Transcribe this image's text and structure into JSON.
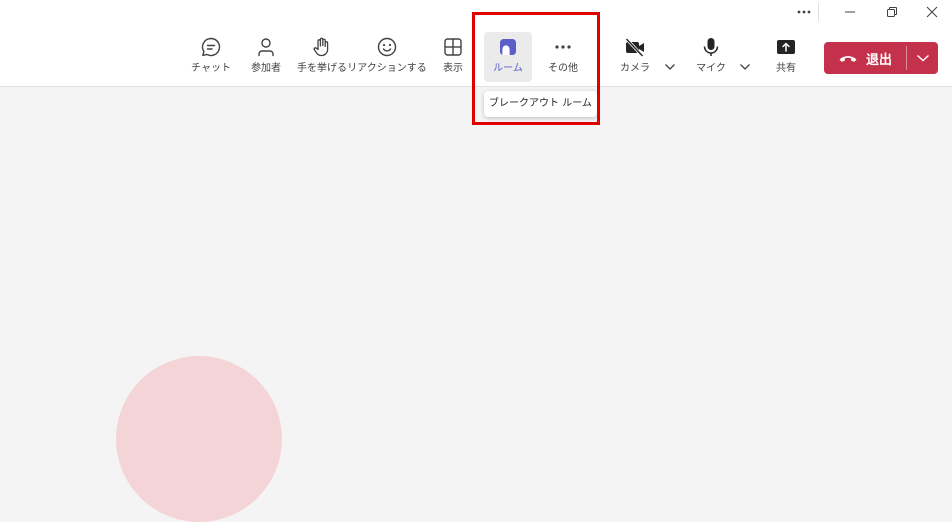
{
  "titlebar": {
    "more_icon": "more-horizontal-icon",
    "minimize_icon": "minimize-icon",
    "restore_icon": "restore-icon",
    "close_icon": "close-icon"
  },
  "toolbar": {
    "chat": {
      "label": "チャット",
      "icon": "chat-icon"
    },
    "participants": {
      "label": "参加者",
      "icon": "people-icon"
    },
    "raise_hand": {
      "label": "手を挙げる",
      "icon": "hand-icon"
    },
    "react": {
      "label": "リアクションする",
      "icon": "smiley-icon"
    },
    "view": {
      "label": "表示",
      "icon": "grid-icon"
    },
    "rooms": {
      "label": "ルーム",
      "icon": "rooms-icon",
      "active": true
    },
    "more": {
      "label": "その他",
      "icon": "more-horizontal-icon"
    },
    "camera": {
      "label": "カメラ",
      "icon": "camera-off-icon"
    },
    "mic": {
      "label": "マイク",
      "icon": "microphone-icon"
    },
    "share": {
      "label": "共有",
      "icon": "share-screen-icon"
    },
    "leave": {
      "label": "退出",
      "icon": "phone-hangup-icon",
      "color": "#c4314b"
    }
  },
  "tooltip": {
    "text": "ブレークアウト ルーム"
  },
  "colors": {
    "accent": "#5b5fc7",
    "leave": "#c4314b",
    "highlight": "#e00000",
    "stage_bg": "#f4f4f4"
  }
}
